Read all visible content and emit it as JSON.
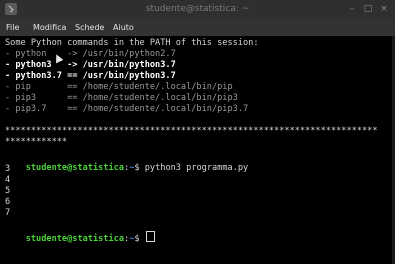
{
  "window": {
    "title": "studente@statistica: ~",
    "min_glyph": "–",
    "max_glyph": "□",
    "close_glyph": "×"
  },
  "menu": {
    "items": [
      "File",
      "Modifica",
      "Schede",
      "Aiuto"
    ]
  },
  "terminal": {
    "header": "Some Python commands in the PATH of this session:",
    "path_lines": [
      {
        "text": "- python    -> /usr/bin/python2.7",
        "style": "dim"
      },
      {
        "text": "- python3   -> /usr/bin/python3.7",
        "style": "bold"
      },
      {
        "text": "- python3.7 == /usr/bin/python3.7",
        "style": "bold"
      },
      {
        "text": "- pip       == /home/studente/.local/bin/pip",
        "style": "dim"
      },
      {
        "text": "- pip3      == /home/studente/.local/bin/pip3",
        "style": "dim"
      },
      {
        "text": "- pip3.7    == /home/studente/.local/bin/pip3.7",
        "style": "dim"
      }
    ],
    "separator_1": "************************************************************************",
    "separator_2": "************",
    "prompt_user": "studente@statistica",
    "prompt_sep": ":",
    "prompt_path": "~",
    "prompt_symbol": "$ ",
    "command": "python3 programma.py",
    "output": [
      "3",
      "4",
      "5",
      "6",
      "7"
    ]
  },
  "icons": {
    "app": "terminal-icon",
    "minimize": "minimize-icon",
    "maximize": "maximize-icon",
    "close": "close-icon",
    "pointer": "mouse-pointer-icon"
  }
}
